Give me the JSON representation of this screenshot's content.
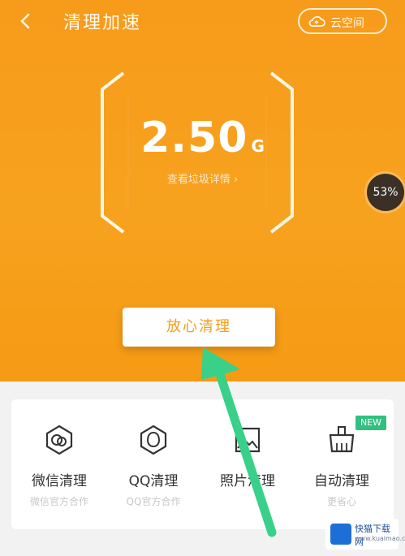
{
  "colors": {
    "accent": "#f79b1a",
    "cta_text": "#f49d19",
    "arrow": "#39d08a",
    "new_badge": "#31c07f",
    "badge_bg": "#3a3026"
  },
  "header": {
    "back_icon": "chevron-left-icon",
    "title": "清理加速",
    "cloud_button_label": "云空间",
    "cloud_icon": "cloud-icon"
  },
  "summary": {
    "size_value": "2.50",
    "size_unit": "G",
    "detail_link": "查看垃圾详情 ›",
    "progress_badge": "53%"
  },
  "cta": {
    "label": "放心清理"
  },
  "tools": [
    {
      "name": "微信清理",
      "desc": "微信官方合作",
      "icon": "wechat-icon"
    },
    {
      "name": "QQ清理",
      "desc": "QQ官方合作",
      "icon": "qq-icon"
    },
    {
      "name": "照片清理",
      "desc": "",
      "icon": "photo-icon"
    },
    {
      "name": "自动清理",
      "desc": "更省心",
      "icon": "broom-icon",
      "badge": "NEW"
    }
  ],
  "watermark": {
    "title": "快猫下载网",
    "sub": "www.kuaimao.com"
  }
}
